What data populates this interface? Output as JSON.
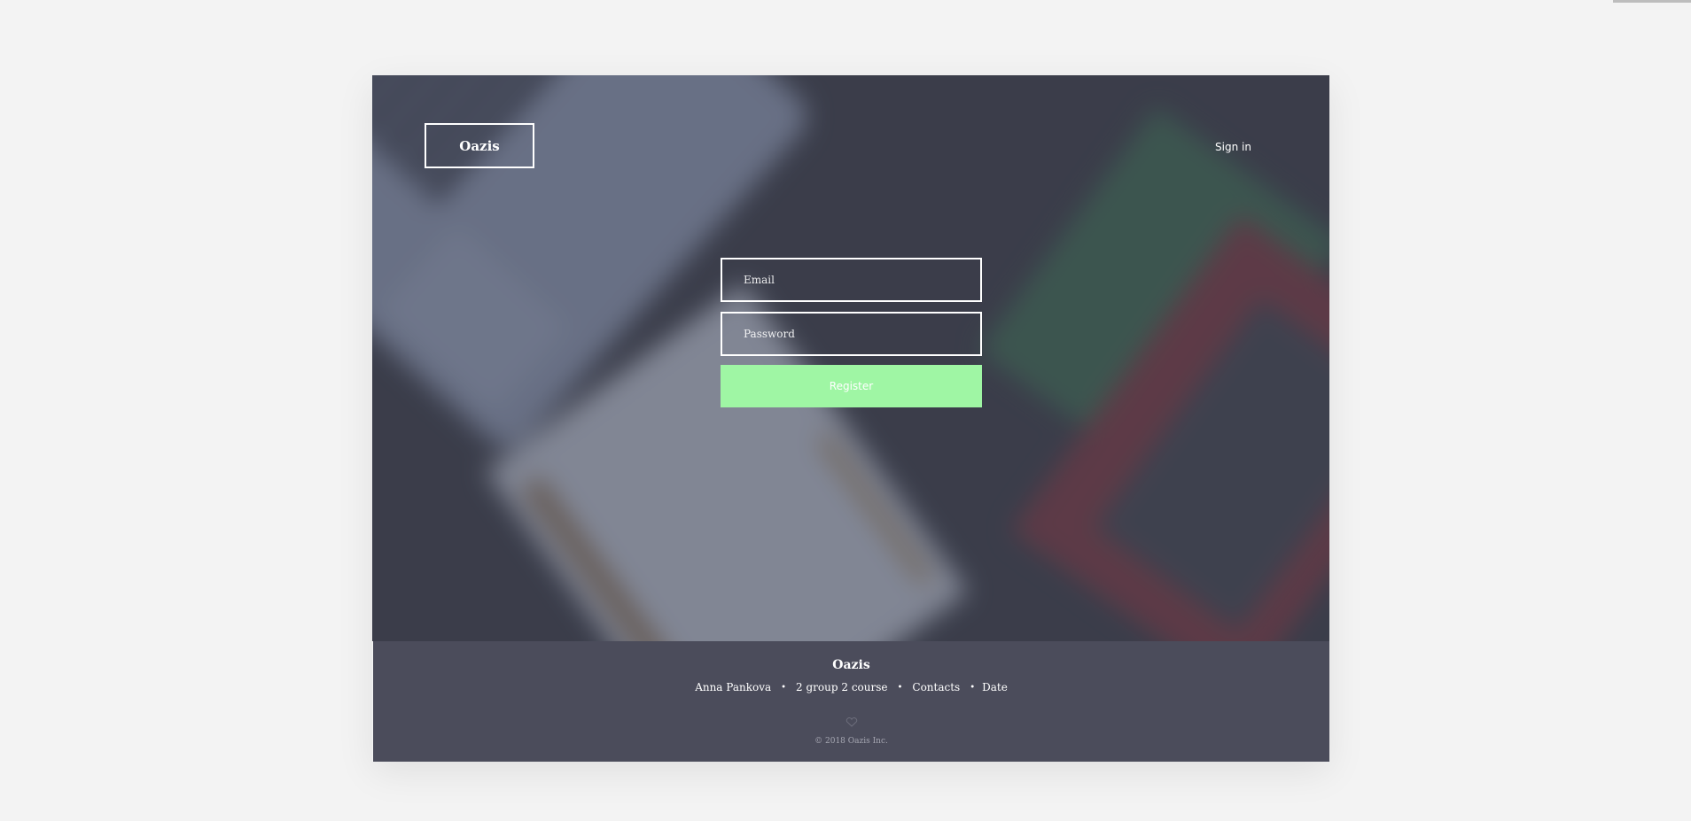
{
  "header": {
    "logo": "Oazis",
    "signin": "Sign in"
  },
  "form": {
    "email_placeholder": "Email",
    "password_placeholder": "Password",
    "register_label": "Register"
  },
  "footer": {
    "title": "Oazis",
    "links": [
      "Anna Pankova",
      "2 group 2 course",
      "Contacts",
      "Date"
    ],
    "separator": "•",
    "copyright": "© 2018 Oazis Inc."
  },
  "icons": {
    "heart": "heart-icon"
  },
  "colors": {
    "page_bg": "#f3f3f3",
    "footer_bg": "#4b4c5b",
    "register_button": "#9ff6a4",
    "hero_overlay": "#3c3f4c"
  }
}
